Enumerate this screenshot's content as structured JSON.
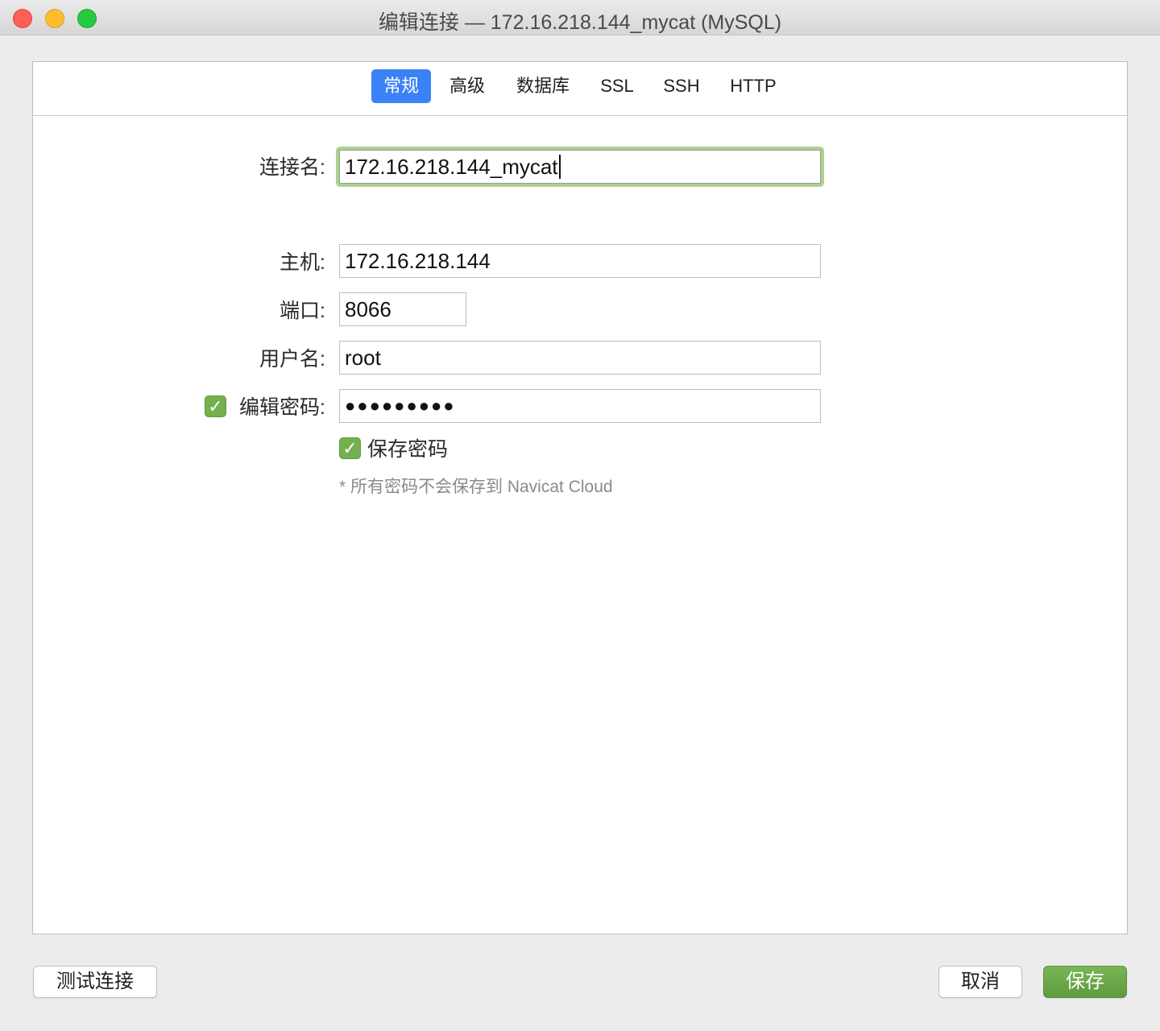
{
  "window": {
    "title": "编辑连接 — 172.16.218.144_mycat (MySQL)"
  },
  "tabs": [
    {
      "label": "常规",
      "active": true
    },
    {
      "label": "高级",
      "active": false
    },
    {
      "label": "数据库",
      "active": false
    },
    {
      "label": "SSL",
      "active": false
    },
    {
      "label": "SSH",
      "active": false
    },
    {
      "label": "HTTP",
      "active": false
    }
  ],
  "form": {
    "connection_name": {
      "label": "连接名:",
      "value": "172.16.218.144_mycat"
    },
    "host": {
      "label": "主机:",
      "value": "172.16.218.144"
    },
    "port": {
      "label": "端口:",
      "value": "8066"
    },
    "username": {
      "label": "用户名:",
      "value": "root"
    },
    "edit_password": {
      "label": "编辑密码:",
      "checked": true,
      "value": "●●●●●●●●●"
    },
    "save_password": {
      "label": "保存密码",
      "checked": true
    },
    "cloud_note": "* 所有密码不会保存到 Navicat Cloud"
  },
  "footer": {
    "test_label": "测试连接",
    "cancel_label": "取消",
    "save_label": "保存"
  },
  "colors": {
    "accent_blue": "#3b82f6",
    "check_green": "#74b04e",
    "focus_ring": "#a9d18e",
    "primary_button": "#6aa849"
  }
}
